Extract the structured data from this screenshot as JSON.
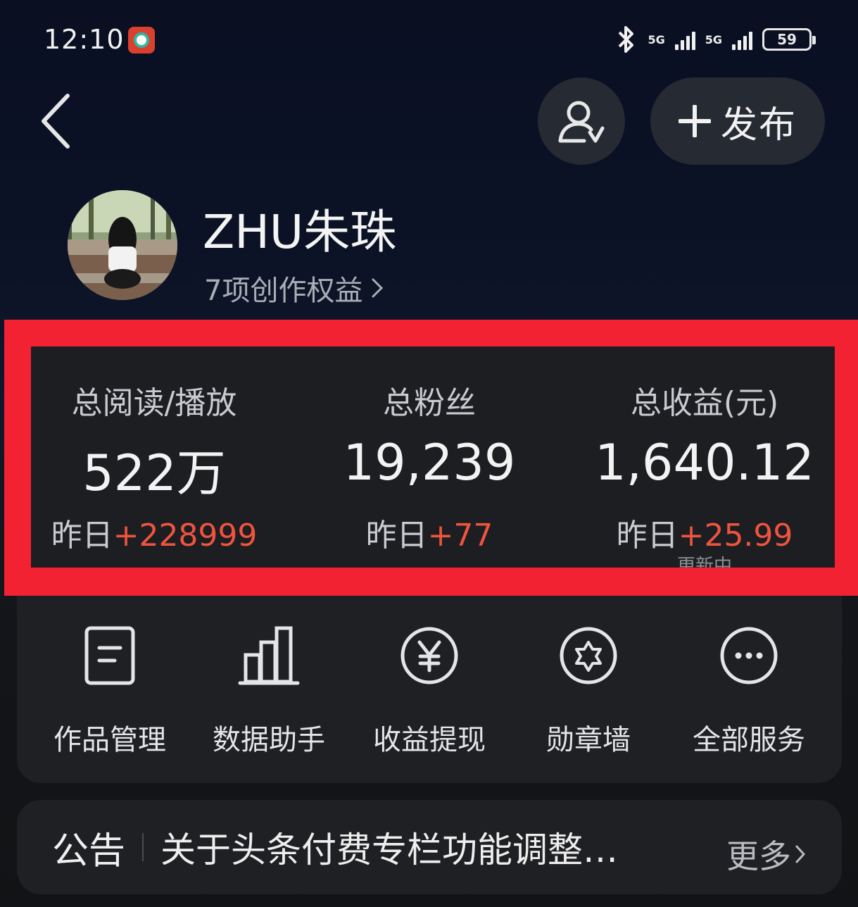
{
  "status_bar": {
    "time": "12:10",
    "network_1": "5G",
    "network_2": "5G",
    "battery": "59"
  },
  "header": {
    "publish_label": "发布"
  },
  "profile": {
    "name": "ZHU朱珠",
    "benefits": "7项创作权益"
  },
  "stats": [
    {
      "label": "总阅读/播放",
      "value": "522万",
      "delta_prefix": "昨日",
      "delta": "+228999",
      "note": ""
    },
    {
      "label": "总粉丝",
      "value": "19,239",
      "delta_prefix": "昨日",
      "delta": "+77",
      "note": ""
    },
    {
      "label": "总收益(元)",
      "value": "1,640.12",
      "delta_prefix": "昨日",
      "delta": "+25.99",
      "note": "更新中"
    }
  ],
  "services": [
    {
      "label": "作品管理",
      "icon": "document-icon"
    },
    {
      "label": "数据助手",
      "icon": "bar-chart-icon"
    },
    {
      "label": "收益提现",
      "icon": "yuan-coin-icon"
    },
    {
      "label": "勋章墙",
      "icon": "medal-icon"
    },
    {
      "label": "全部服务",
      "icon": "more-dots-icon"
    }
  ],
  "notice": {
    "tag": "公告",
    "text": "关于头条付费专栏功能调整…",
    "more": "更多"
  },
  "colors": {
    "highlight_red": "#f22233",
    "positive_delta": "#f0533f",
    "card_bg": "#1f2023"
  }
}
